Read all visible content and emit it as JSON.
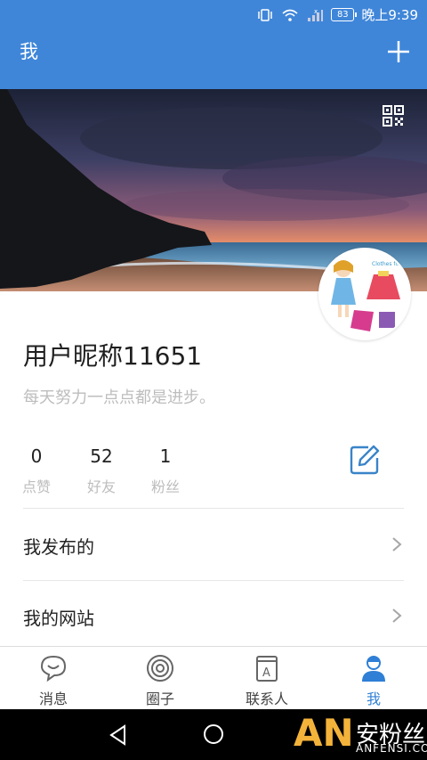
{
  "status_bar": {
    "battery": "83",
    "time": "晚上9:39"
  },
  "header": {
    "title": "我"
  },
  "profile": {
    "nickname": "用户昵称11651",
    "signature": "每天努力一点点都是进步。",
    "stats": [
      {
        "value": "0",
        "label": "点赞"
      },
      {
        "value": "52",
        "label": "好友"
      },
      {
        "value": "1",
        "label": "粉丝"
      }
    ]
  },
  "menu": [
    {
      "label": "我发布的"
    },
    {
      "label": "我的网站"
    }
  ],
  "tabs": [
    {
      "label": "消息",
      "icon": "chat-bubble-icon"
    },
    {
      "label": "圈子",
      "icon": "circle-icon"
    },
    {
      "label": "联系人",
      "icon": "contacts-book-icon"
    },
    {
      "label": "我",
      "icon": "user-icon"
    }
  ],
  "active_tab": "我",
  "watermark": {
    "logo": "AN",
    "cn": "安粉丝",
    "en": "ANFENSI.COM"
  },
  "colors": {
    "accent": "#3f86d9",
    "active_tab": "#2f7fd6"
  }
}
